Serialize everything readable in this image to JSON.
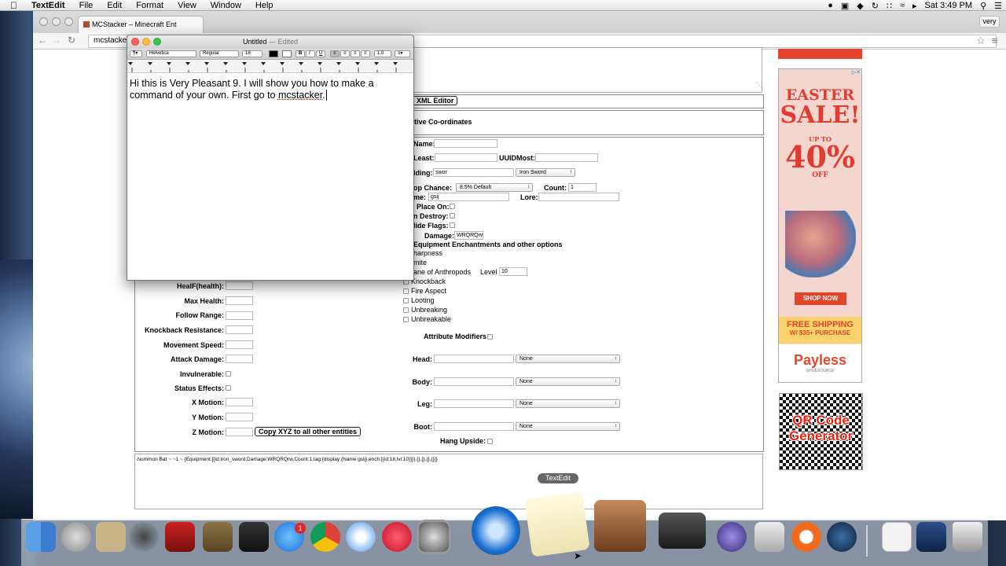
{
  "menubar": {
    "app_name": "TextEdit",
    "items": [
      "File",
      "Edit",
      "Format",
      "View",
      "Window",
      "Help"
    ],
    "clock": "Sat 3:49 PM"
  },
  "browser": {
    "tab_title": "MCStacker – Minecraft Ent",
    "address": "mcstacker",
    "profile": "very"
  },
  "page": {
    "xml_editor_button": "XML Editor",
    "relative_coords_label": "tive Co-ordinates",
    "item": {
      "name_label": "Name:",
      "least_label": "Least:",
      "uuidmost_label": "UUIDMost:",
      "holding_label": "lding:",
      "holding_value": "swor",
      "holding_select": "Iron Sword",
      "drop_label": "op Chance:",
      "drop_select": "8.5% Default",
      "count_label": "Count:",
      "count_value": "1",
      "displayname_label": "me:",
      "displayname_value": "gsij",
      "lore_label": "Lore:",
      "place_on_label": "Place On:",
      "can_destroy_label": "n Destroy:",
      "hide_flags_label": "lide Flags:",
      "damage_label": "Damage:",
      "damage_value": "WRQRQrw",
      "ench_header": "Equipment Enchantments and other options",
      "ench": [
        "harpness",
        "mite",
        "ane of Anthropods",
        "Knockback",
        "Fire Aspect",
        "Looting",
        "Unbreaking",
        "Unbreakable"
      ],
      "level_label": "Level",
      "level_value": "10",
      "attr_mod_label": "Attribute Modifiers"
    },
    "mob": {
      "health_label": "HealF(health):",
      "max_health_label": "Max Health:",
      "follow_range_label": "Follow Range:",
      "knockback_res_label": "Knockback Resistance:",
      "movement_speed_label": "Movement Speed:",
      "attack_damage_label": "Attack Damage:",
      "invulnerable_label": "Invulnerable:",
      "status_effects_label": "Status Effects:",
      "x_motion_label": "X Motion:",
      "y_motion_label": "Y Motion:",
      "z_motion_label": "Z Motion:",
      "copy_xyz_button": "Copy XYZ to all other entities"
    },
    "armor": {
      "head_label": "Head:",
      "body_label": "Body:",
      "leg_label": "Leg:",
      "boot_label": "Boot:",
      "none": "None",
      "hang_upside_label": "Hang Upside:"
    },
    "command_output": "/summon Bat ~ ~1 ~ {Equipment:[{id:iron_sword,Damage:WRQRQrw,Count:1,tag:{display:{Name:gsij},ench:[{id:18,lvl:10}]}},{},{},{},{}]}"
  },
  "ads": {
    "easter_line1": "EASTER",
    "easter_line2": "SALE!",
    "easter_pct_pre": "UP TO",
    "easter_pct": "40%",
    "easter_pct_post": "OFF",
    "shop_now": "SHOP NOW",
    "free_shipping": "FREE SHIPPING",
    "free_shipping_sub": "W/ $35+ PURCHASE",
    "brand": "Payless",
    "brand_sub": "SHOESOURCE",
    "qr_line1": "QR Code",
    "qr_line2": "Generator"
  },
  "textedit": {
    "title": "Untitled",
    "edited": "— Edited",
    "font": "Helvetica",
    "style": "Regular",
    "size": "18",
    "spacing": "1.0",
    "body_before": "Hi this is Very Pleasant 9. I will show you how to make a command of your own. First go to ",
    "body_misspelled": "mcstacker",
    "body_after": ". "
  },
  "dock": {
    "tooltip": "TextEdit"
  }
}
